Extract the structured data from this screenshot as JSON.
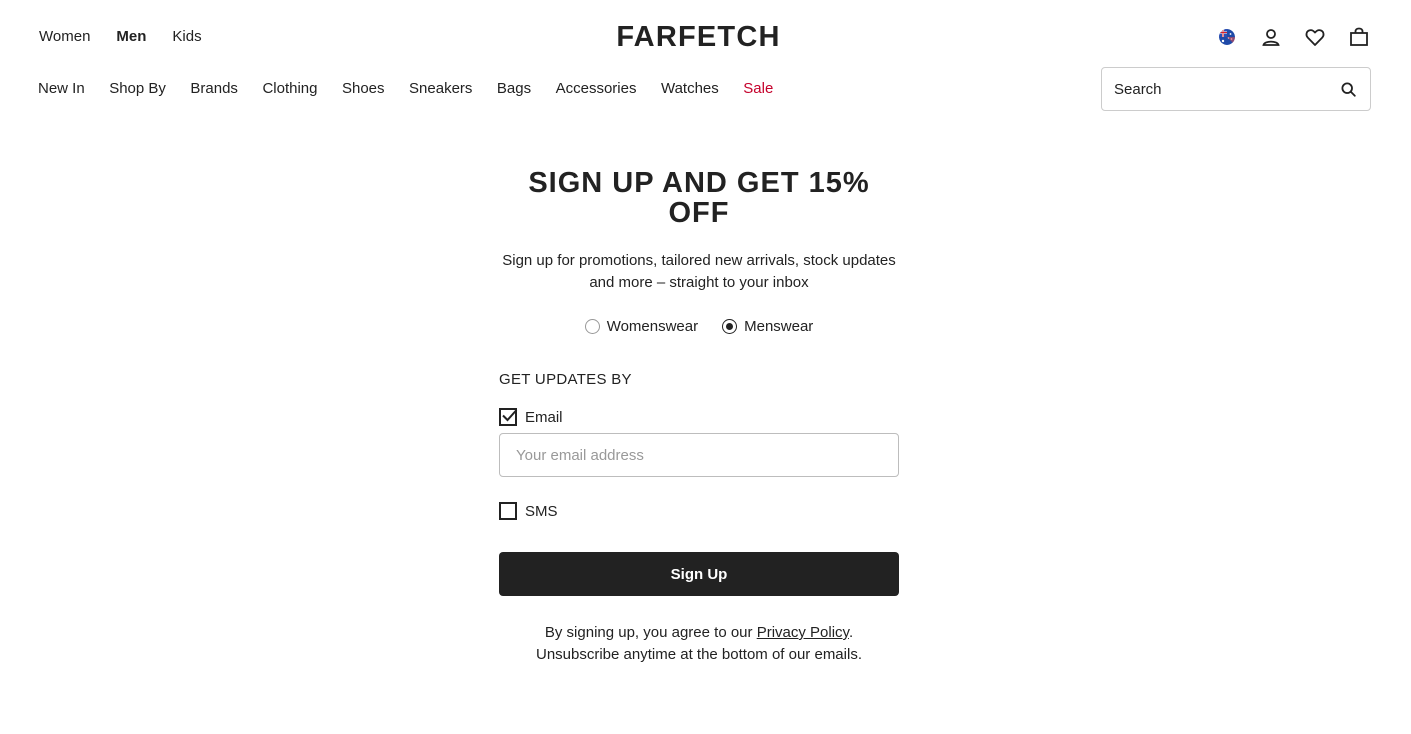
{
  "departments": [
    {
      "label": "Women",
      "active": false
    },
    {
      "label": "Men",
      "active": true
    },
    {
      "label": "Kids",
      "active": false
    }
  ],
  "logo": "FARFETCH",
  "utility": {
    "region_icon": "australia-flag-icon",
    "account_icon": "user-icon",
    "wishlist_icon": "heart-icon",
    "bag_icon": "bag-icon"
  },
  "categories": [
    "New In",
    "Shop By",
    "Brands",
    "Clothing",
    "Shoes",
    "Sneakers",
    "Bags",
    "Accessories",
    "Watches",
    "Sale"
  ],
  "search": {
    "placeholder": "Search"
  },
  "signup": {
    "title": "SIGN UP AND GET 15% OFF",
    "subtitle": "Sign up for promotions, tailored new arrivals, stock updates and more – straight to your inbox",
    "gender_options": [
      {
        "label": "Womenswear",
        "selected": false
      },
      {
        "label": "Menswear",
        "selected": true
      }
    ],
    "updates_label": "GET UPDATES BY",
    "email_label": "Email",
    "email_checked": true,
    "email_placeholder": "Your email address",
    "sms_label": "SMS",
    "sms_checked": false,
    "button_label": "Sign Up",
    "legal_prefix": "By signing up, you agree to our ",
    "legal_link": "Privacy Policy",
    "legal_suffix": ".",
    "legal_line2": "Unsubscribe anytime at the bottom of our emails."
  },
  "colors": {
    "text": "#222222",
    "sale": "#c5022c",
    "button_bg": "#222222",
    "border": "#cccccc"
  }
}
